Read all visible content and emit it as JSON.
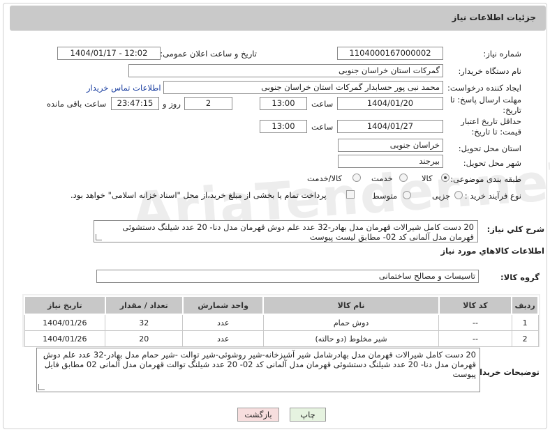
{
  "header": {
    "title": "جزئیات اطلاعات نیاز"
  },
  "form": {
    "need_number": {
      "label": "شماره نیاز:",
      "value": "1104000167000002"
    },
    "announce": {
      "label": "تاریخ و ساعت اعلان عمومی:",
      "value": "1404/01/17 - 12:02"
    },
    "buyer_org": {
      "label": "نام دستگاه خریدار:",
      "value": "گمرکات استان خراسان جنوبی"
    },
    "requester": {
      "label": "ایجاد کننده درخواست:",
      "value": "محمد نبی پور حسابدار گمرکات استان خراسان جنوبی",
      "contact_link": "اطلاعات تماس خریدار"
    },
    "deadline": {
      "label": "مهلت ارسال پاسخ: تا تاریخ:",
      "date": "1404/01/20",
      "time_label": "ساعت",
      "time": "13:00",
      "days": "2",
      "days_label": "روز و",
      "remaining": "23:47:15",
      "remaining_label": "ساعت باقی مانده"
    },
    "validity": {
      "label": "حداقل تاریخ اعتبار قیمت: تا تاریخ:",
      "date": "1404/01/27",
      "time_label": "ساعت",
      "time": "13:00"
    },
    "province": {
      "label": "استان محل تحویل:",
      "value": "خراسان جنوبی"
    },
    "city": {
      "label": "شهر محل تحویل:",
      "value": "بیرجند"
    },
    "category": {
      "label": "طبقه بندی موضوعی:",
      "options": [
        "کالا",
        "خدمت",
        "کالا/خدمت"
      ],
      "selected": "کالا"
    },
    "purchase_type": {
      "label": "نوع فرآیند خرید :",
      "options": [
        "جزیی",
        "متوسط"
      ],
      "selected": "",
      "checkbox_text": "پرداخت تمام یا بخشی از مبلغ خرید،از محل \"اسناد خزانه اسلامی\" خواهد بود."
    }
  },
  "summary": {
    "label": "شرح کلي نياز:",
    "text": "20 دست کامل شیرالات قهرمان مدل بهادر-32 عدد علم دوش قهرمان مدل دنا- 20 عدد شیلنگ دستشوئی قهرمان مدل آلمانی کد 02- مطابق لیست پیوست"
  },
  "goods_section": {
    "title": "اطلاعات کالاهاي مورد نياز",
    "group_label": "گروه کالا:",
    "group_value": "تاسیسات و مصالح ساختمانی"
  },
  "table": {
    "headers": [
      "ردیف",
      "کد کالا",
      "نام کالا",
      "واحد شمارش",
      "تعداد / مقدار",
      "تاریخ نیاز"
    ],
    "rows": [
      [
        "1",
        "--",
        "دوش حمام",
        "عدد",
        "32",
        "1404/01/26"
      ],
      [
        "2",
        "--",
        "شیر مخلوط (دو حالته)",
        "عدد",
        "20",
        "1404/01/26"
      ]
    ]
  },
  "buyer_notes": {
    "label": "توضیحات خریدار:",
    "text": "20 دست کامل شیرالات قهرمان مدل بهادرشامل شیر آشپزخانه-شیر روشوئی-شیر توالت -شیر حمام مدل بهادر-32 عدد علم دوش قهرمان مدل دنا- 20 عدد شیلنگ دستشوئی قهرمان مدل آلمانی کد 02- 20 عدد شیلنگ توالت قهرمان مدل آلمانی 02 مطابق فایل پیوست"
  },
  "buttons": {
    "print": "چاپ",
    "back": "بازگشت"
  },
  "watermark": {
    "text": "AriaTender.neT"
  },
  "colors": {
    "header_bg": "#c9c9c9",
    "link": "#1a3ea0",
    "back_btn_bg": "#f7dede",
    "print_btn_bg": "#e6f3e0"
  }
}
